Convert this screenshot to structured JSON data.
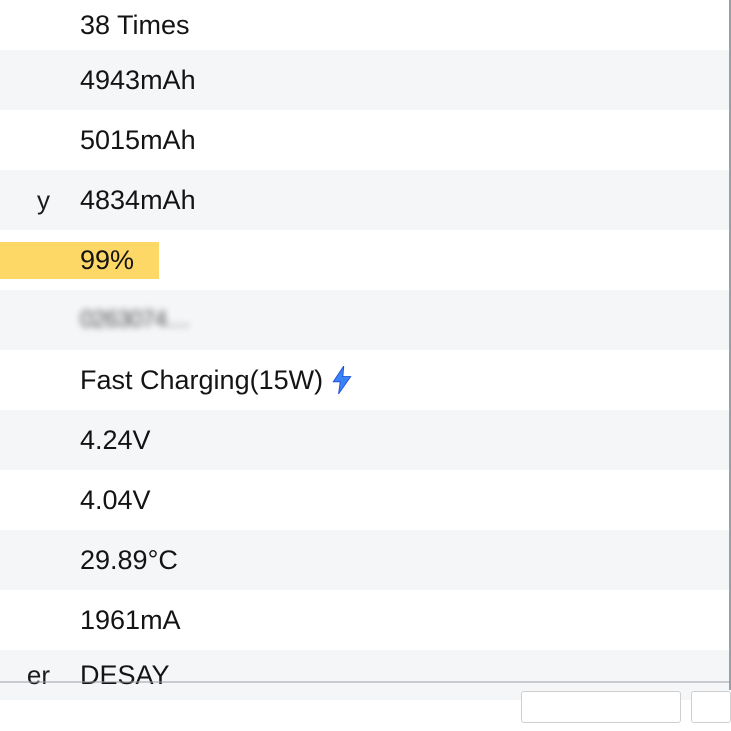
{
  "rows": [
    {
      "label": "",
      "value": "38 Times"
    },
    {
      "label": "",
      "value": "4943mAh"
    },
    {
      "label": "",
      "value": "5015mAh"
    },
    {
      "label": "y",
      "value": "4834mAh"
    },
    {
      "label": "",
      "value": "99%",
      "highlight": true
    },
    {
      "label": "",
      "value": "0263074…",
      "blurred": true
    },
    {
      "label": "",
      "value": "Fast Charging(15W)",
      "hasBolt": true
    },
    {
      "label": "",
      "value": "4.24V"
    },
    {
      "label": "",
      "value": "4.04V"
    },
    {
      "label": "",
      "value": "29.89°C"
    },
    {
      "label": "",
      "value": "1961mA"
    },
    {
      "label": "er",
      "value": "DESAY"
    }
  ],
  "icons": {
    "bolt": "bolt-icon"
  }
}
